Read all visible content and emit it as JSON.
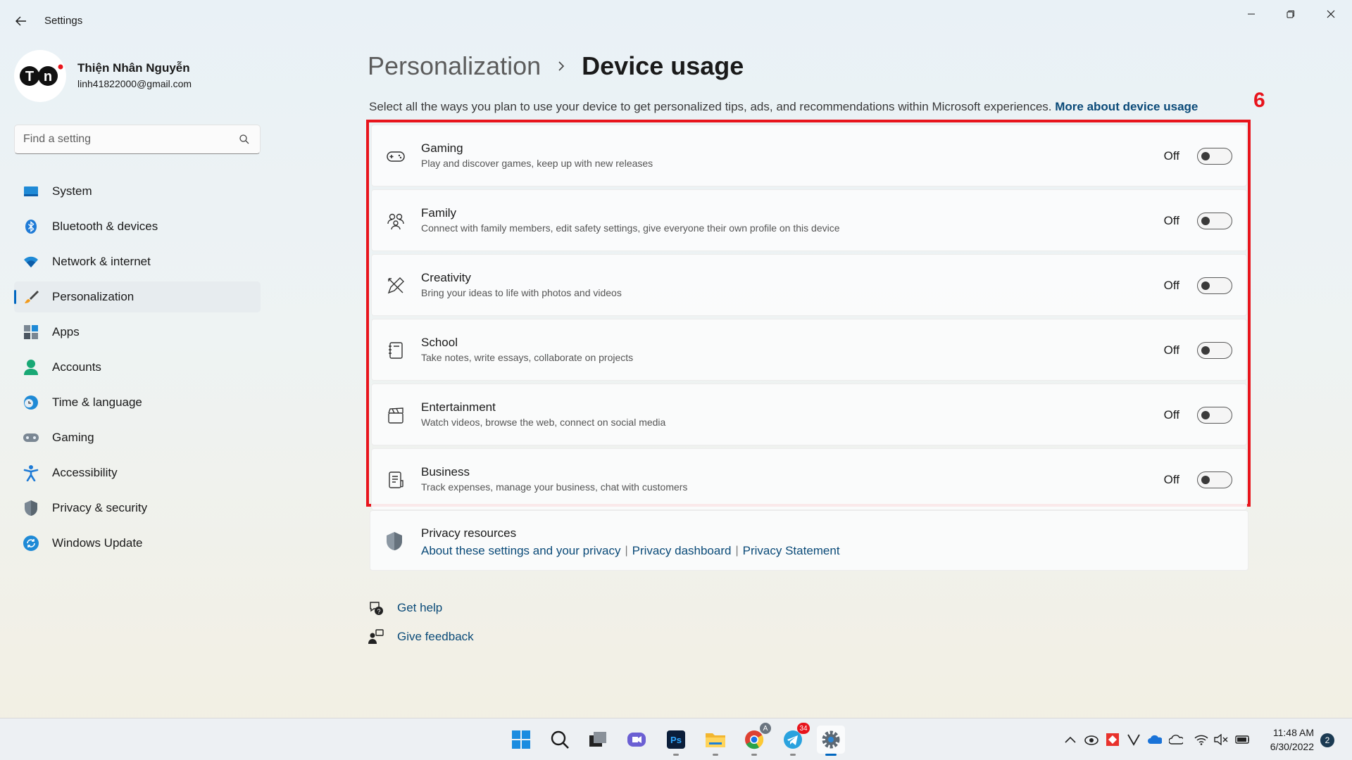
{
  "window": {
    "title": "Settings"
  },
  "user": {
    "initials": "TN",
    "name": "Thiện Nhân Nguyễn",
    "email": "linh41822000@gmail.com"
  },
  "search": {
    "placeholder": "Find a setting"
  },
  "nav": {
    "items": [
      {
        "label": "System"
      },
      {
        "label": "Bluetooth & devices"
      },
      {
        "label": "Network & internet"
      },
      {
        "label": "Personalization"
      },
      {
        "label": "Apps"
      },
      {
        "label": "Accounts"
      },
      {
        "label": "Time & language"
      },
      {
        "label": "Gaming"
      },
      {
        "label": "Accessibility"
      },
      {
        "label": "Privacy & security"
      },
      {
        "label": "Windows Update"
      }
    ]
  },
  "breadcrumb": {
    "parent": "Personalization",
    "current": "Device usage"
  },
  "description": {
    "text": "Select all the ways you plan to use your device to get personalized tips, ads, and recommendations within Microsoft experiences.",
    "link": "More about device usage"
  },
  "annotation": {
    "number": "6",
    "color": "#e8141c"
  },
  "usages": [
    {
      "title": "Gaming",
      "subtitle": "Play and discover games, keep up with new releases",
      "state": "Off",
      "icon": "gamepad-icon"
    },
    {
      "title": "Family",
      "subtitle": "Connect with family members, edit safety settings, give everyone their own profile on this device",
      "state": "Off",
      "icon": "family-icon"
    },
    {
      "title": "Creativity",
      "subtitle": "Bring your ideas to life with photos and videos",
      "state": "Off",
      "icon": "pencil-ruler-icon"
    },
    {
      "title": "School",
      "subtitle": "Take notes, write essays, collaborate on projects",
      "state": "Off",
      "icon": "notebook-icon"
    },
    {
      "title": "Entertainment",
      "subtitle": "Watch videos, browse the web, connect on social media",
      "state": "Off",
      "icon": "clapperboard-icon"
    },
    {
      "title": "Business",
      "subtitle": "Track expenses, manage your business, chat with customers",
      "state": "Off",
      "icon": "document-icon"
    }
  ],
  "privacy": {
    "title": "Privacy resources",
    "links": [
      "About these settings and your privacy",
      "Privacy dashboard",
      "Privacy Statement"
    ],
    "separator": "|"
  },
  "help": {
    "get_help": "Get help",
    "give_feedback": "Give feedback"
  },
  "taskbar": {
    "telegram_badge": "34",
    "chrome_badge": "A",
    "time": "11:48 AM",
    "date": "6/30/2022",
    "notifications": "2"
  },
  "colors": {
    "accent": "#0067c0",
    "link": "#0a4a78",
    "annotation": "#e8141c"
  }
}
